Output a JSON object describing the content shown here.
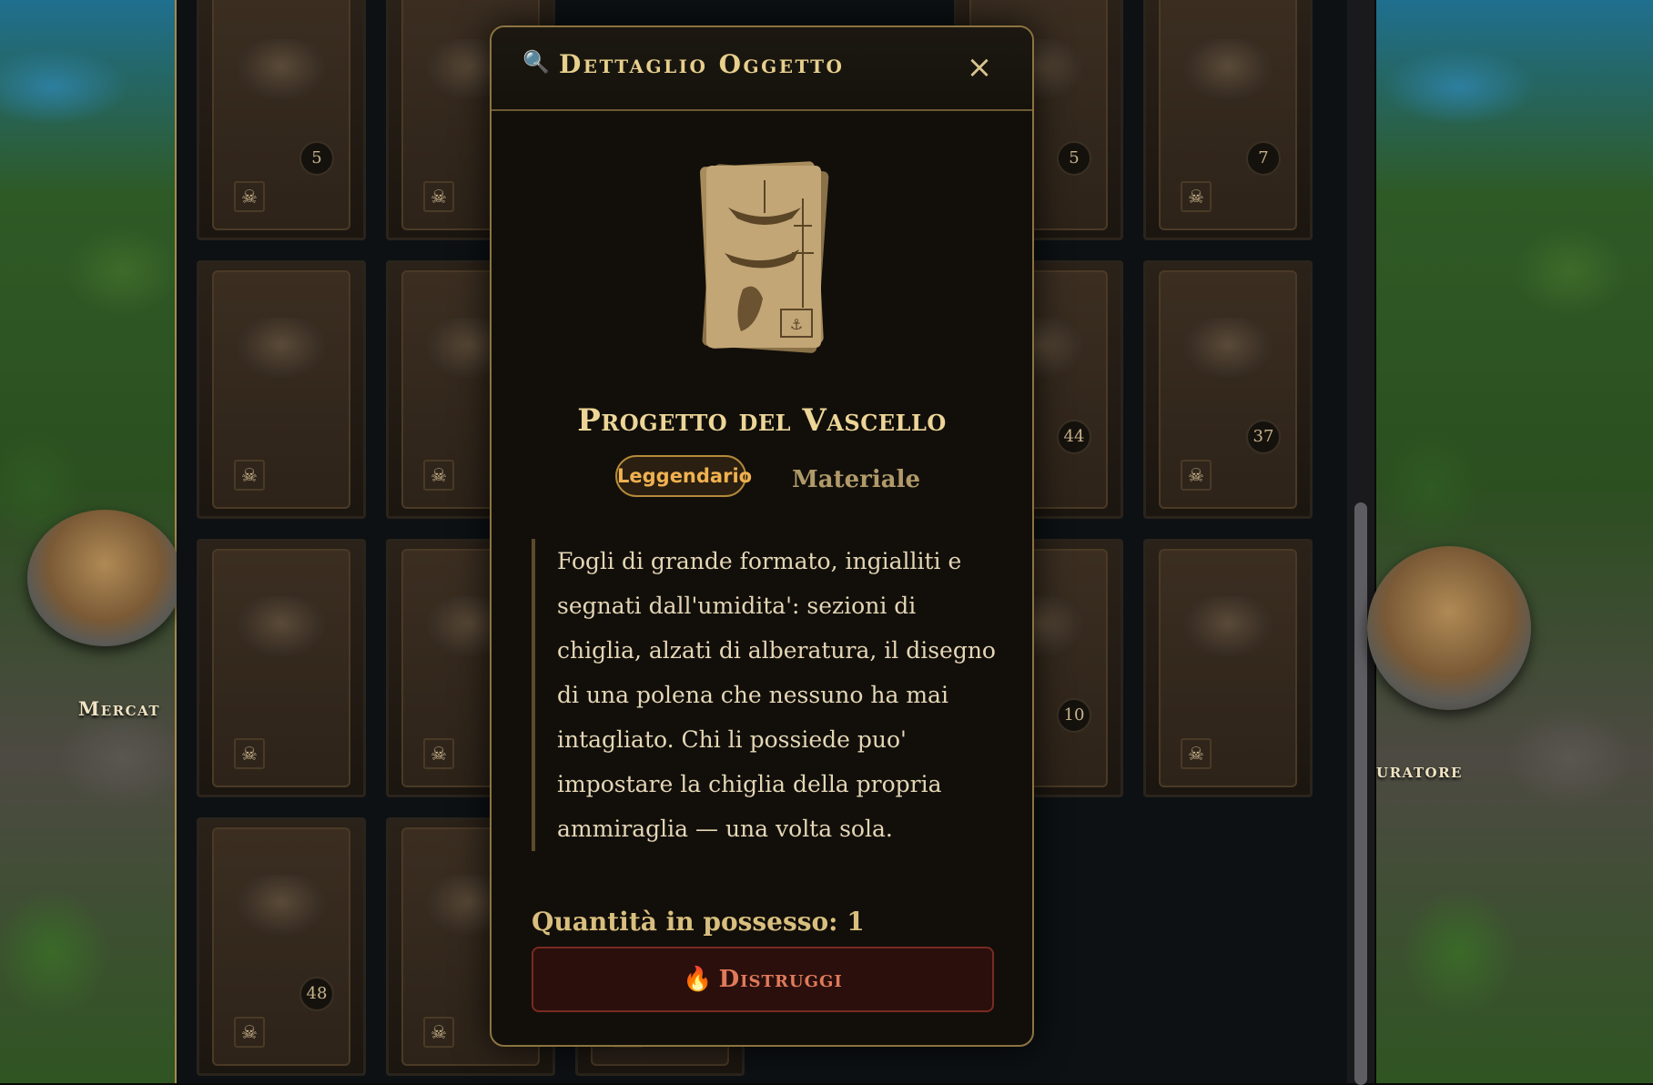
{
  "background": {
    "left_building_label": "Mercat",
    "right_building_label": "uratore"
  },
  "inventory": {
    "counts": [
      "5",
      "5",
      "7",
      "44",
      "37",
      "10",
      "48"
    ],
    "slot_marker": "☠"
  },
  "modal": {
    "title_icon": "magnifier-icon",
    "title": "Dettaglio Oggetto",
    "close_label": "×",
    "item": {
      "name": "Progetto del Vascello",
      "rarity": "Leggendario",
      "type": "Materiale",
      "description": "Fogli di grande formato, ingialliti e segnati dall'umidita': sezioni di chiglia, alzati di alberatura, il disegno di una polena che nessuno ha mai intagliato. Chi li possiede puo' impostare la chiglia della propria ammiraglia — una volta sola.",
      "quantity_text": "Quantità in possesso: 1"
    },
    "destroy_label": "Distruggi",
    "destroy_icon": "🔥"
  },
  "colors": {
    "accent_gold": "#ecd597",
    "rarity_legendary": "#f0b150",
    "danger": "#e07a5a"
  }
}
